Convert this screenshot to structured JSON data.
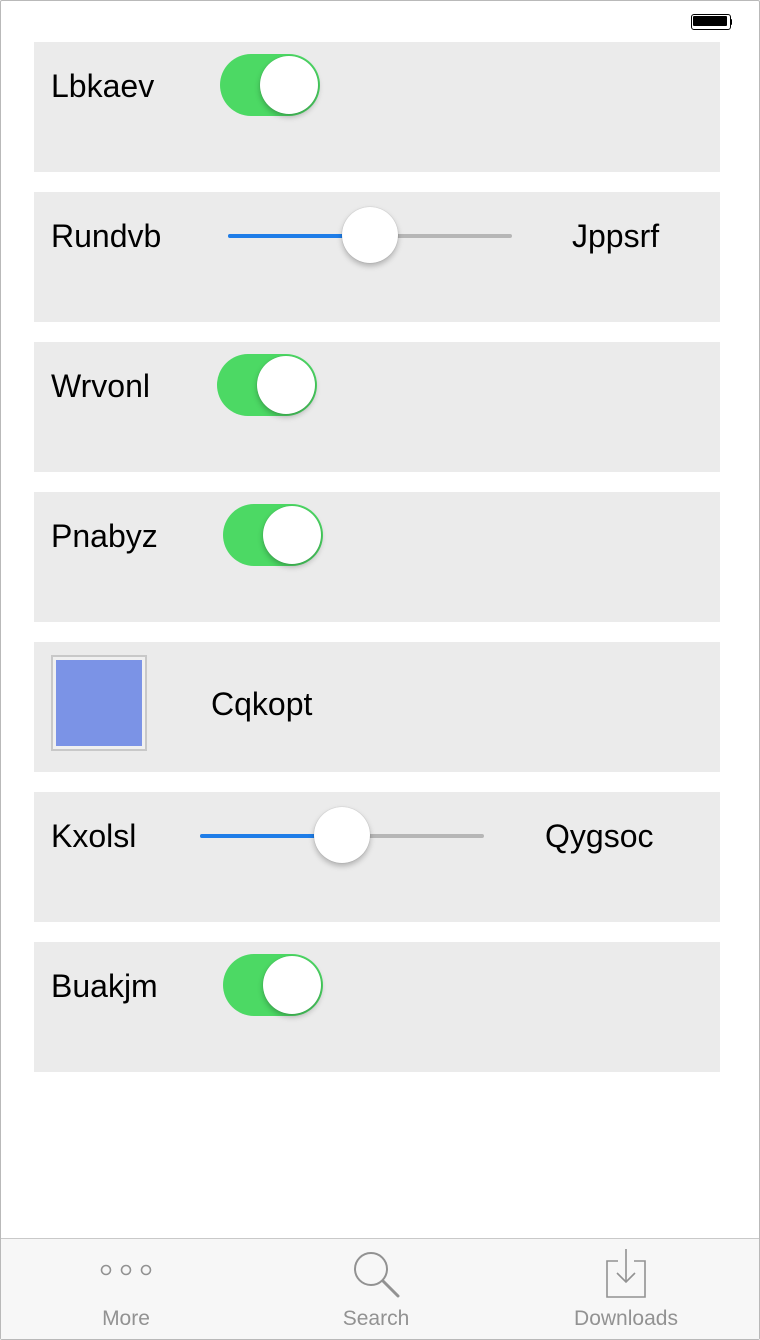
{
  "colors": {
    "toggle_on": "#4cd964",
    "slider_fill": "#1e7de8",
    "slider_track": "#b6b6b6",
    "row_bg": "#ebebeb",
    "swatch": "#7b93e6",
    "tab_label": "#929292"
  },
  "rows": [
    {
      "type": "toggle",
      "label": "Lbkaev",
      "on": true
    },
    {
      "type": "slider",
      "label_left": "Rundvb",
      "label_right": "Jppsrf",
      "value": 0.5
    },
    {
      "type": "toggle",
      "label": "Wrvonl",
      "on": true
    },
    {
      "type": "toggle",
      "label": "Pnabyz",
      "on": true
    },
    {
      "type": "color",
      "label": "Cqkopt",
      "color": "#7b93e6"
    },
    {
      "type": "slider",
      "label_left": "Kxolsl",
      "label_right": "Qygsoc",
      "value": 0.5
    },
    {
      "type": "toggle",
      "label": "Buakjm",
      "on": true
    }
  ],
  "tabbar": {
    "tabs": [
      {
        "label": "More",
        "icon": "more-dots-icon"
      },
      {
        "label": "Search",
        "icon": "search-icon"
      },
      {
        "label": "Downloads",
        "icon": "downloads-icon"
      }
    ]
  }
}
